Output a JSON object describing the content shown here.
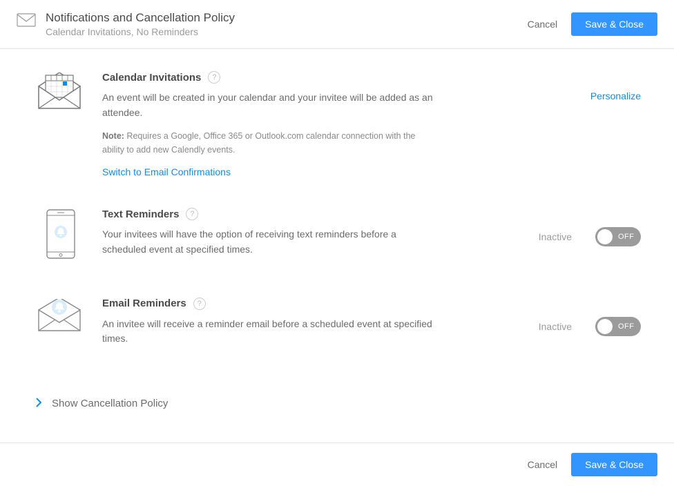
{
  "header": {
    "title": "Notifications and Cancellation Policy",
    "subtitle": "Calendar Invitations, No Reminders",
    "cancel_label": "Cancel",
    "save_label": "Save & Close"
  },
  "sections": {
    "calendar_invitations": {
      "title": "Calendar Invitations",
      "description": "An event will be created in your calendar and your invitee will be added as an attendee.",
      "note_label": "Note:",
      "note_text": " Requires a Google, Office 365 or Outlook.com calendar connection with the ability to add new Calendly events.",
      "switch_link": "Switch to Email Confirmations",
      "personalize_link": "Personalize"
    },
    "text_reminders": {
      "title": "Text Reminders",
      "description": "Your invitees will have the option of receiving text reminders before a scheduled event at specified times.",
      "status": "Inactive",
      "toggle_label": "OFF"
    },
    "email_reminders": {
      "title": "Email Reminders",
      "description": "An invitee will receive a reminder email before a scheduled event at specified times.",
      "status": "Inactive",
      "toggle_label": "OFF"
    }
  },
  "show_policy": "Show Cancellation Policy",
  "footer": {
    "cancel_label": "Cancel",
    "save_label": "Save & Close"
  },
  "help_glyph": "?"
}
